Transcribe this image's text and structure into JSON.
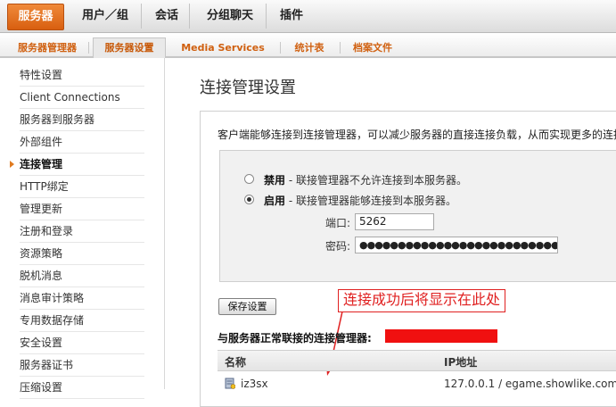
{
  "top_tabs": [
    {
      "label": "服务器",
      "active": true
    },
    {
      "label": "用户／组",
      "active": false
    },
    {
      "label": "会话",
      "active": false
    },
    {
      "label": "分组聊天",
      "active": false
    },
    {
      "label": "插件",
      "active": false
    }
  ],
  "sub_tabs": [
    {
      "label": "服务器管理器",
      "active": false
    },
    {
      "label": "服务器设置",
      "active": true
    },
    {
      "label": "Media Services",
      "active": false
    },
    {
      "label": "统计表",
      "active": false
    },
    {
      "label": "档案文件",
      "active": false
    }
  ],
  "sidebar": {
    "items": [
      {
        "label": "特性设置",
        "active": false
      },
      {
        "label": "Client Connections",
        "active": false
      },
      {
        "label": "服务器到服务器",
        "active": false
      },
      {
        "label": "外部组件",
        "active": false
      },
      {
        "label": "连接管理",
        "active": true
      },
      {
        "label": "HTTP绑定",
        "active": false
      },
      {
        "label": "管理更新",
        "active": false
      },
      {
        "label": "注册和登录",
        "active": false
      },
      {
        "label": "资源策略",
        "active": false
      },
      {
        "label": "脱机消息",
        "active": false
      },
      {
        "label": "消息审计策略",
        "active": false
      },
      {
        "label": "专用数据存储",
        "active": false
      },
      {
        "label": "安全设置",
        "active": false
      },
      {
        "label": "服务器证书",
        "active": false
      },
      {
        "label": "压缩设置",
        "active": false
      }
    ]
  },
  "main": {
    "title": "连接管理设置",
    "description": "客户端能够连接到连接管理器，可以减少服务器的直接连接负载，从而实现更多的连接",
    "disable_option": {
      "label": "禁用",
      "desc": " - 联接管理器不允许连接到本服务器。",
      "checked": false
    },
    "enable_option": {
      "label": "启用",
      "desc": " - 联接管理器能够连接到本服务器。",
      "checked": true
    },
    "port_label": "端口:",
    "port_value": "5262",
    "password_label": "密码:",
    "password_value": "●●●●●●●●●●●●●●●●●●●●●●●●●●●●●●●●●●●●●●●●●",
    "save_button": "保存设置",
    "annotation": "连接成功后将显示在此处",
    "connected_label": "与服务器正常联接的连接管理器:",
    "table": {
      "headers": [
        "名称",
        "IP地址"
      ],
      "rows": [
        {
          "name": "iz3sx",
          "ip": "127.0.0.1 / egame.showlike.com"
        }
      ]
    }
  },
  "colors": {
    "accent_orange": "#e07b20",
    "annotation_red": "#e02020",
    "redaction_red": "#f01010"
  }
}
